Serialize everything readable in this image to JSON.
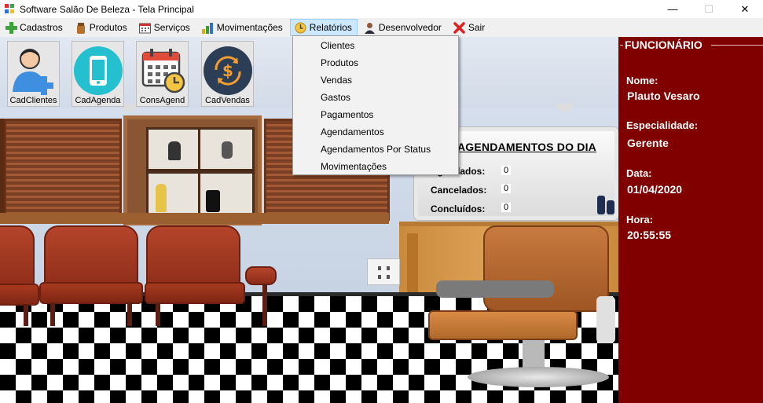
{
  "window": {
    "title": "Software Salão De Beleza - Tela Principal",
    "minimize": "—",
    "maximize": "☐",
    "close": "✕"
  },
  "menu": {
    "items": [
      {
        "label": "Cadastros",
        "icon": "plus-icon"
      },
      {
        "label": "Produtos",
        "icon": "jar-icon"
      },
      {
        "label": "Serviços",
        "icon": "calendar-icon"
      },
      {
        "label": "Movimentações",
        "icon": "bar-chart-icon"
      },
      {
        "label": "Relatórios",
        "icon": "report-icon"
      },
      {
        "label": "Desenvolvedor",
        "icon": "person-icon"
      },
      {
        "label": "Sair",
        "icon": "close-x-icon"
      }
    ],
    "open_menu": "Relatórios",
    "active_color": "#cce8ff"
  },
  "dropdown": {
    "items": [
      "Clientes",
      "Produtos",
      "Vendas",
      "Gastos",
      "Pagamentos",
      "Agendamentos",
      "Agendamentos Por Status",
      "Movimentações"
    ]
  },
  "toolbar": {
    "buttons": [
      {
        "label": "CadClientes",
        "icon": "add-user-icon"
      },
      {
        "label": "CadAgenda",
        "icon": "mobile-phone-icon"
      },
      {
        "label": "ConsAgend",
        "icon": "calendar-clock-icon"
      },
      {
        "label": "CadVendas",
        "icon": "money-cycle-icon"
      }
    ]
  },
  "board": {
    "title": "AGENDAMENTOS DO DIA",
    "rows": [
      {
        "label": "Agendados:",
        "value": "0"
      },
      {
        "label": "Cancelados:",
        "value": "0"
      },
      {
        "label": "Concluídos:",
        "value": "0"
      }
    ]
  },
  "panel": {
    "title": "FUNCIONÁRIO",
    "name_label": "Nome:",
    "name_value": "Plauto Vesaro",
    "specialty_label": "Especialidade:",
    "specialty_value": "Gerente",
    "date_label": "Data:",
    "date_value": "01/04/2020",
    "time_label": "Hora:",
    "time_value": "20:55:55",
    "background_color": "#800000"
  }
}
